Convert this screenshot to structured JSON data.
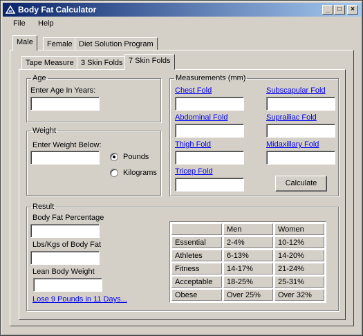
{
  "window": {
    "title": "Body Fat Calculator",
    "minimize": "_",
    "maximize": "□",
    "close": "×"
  },
  "menu": {
    "file": "File",
    "help": "Help"
  },
  "main_tabs": [
    "Male",
    "Female",
    "Diet Solution Program"
  ],
  "sub_tabs": [
    "Tape Measure",
    "3 Skin Folds",
    "7 Skin Folds"
  ],
  "age": {
    "legend": "Age",
    "label": "Enter Age In Years:",
    "value": ""
  },
  "weight": {
    "legend": "Weight",
    "label": "Enter Weight Below:",
    "value": "",
    "pounds": "Pounds",
    "kilograms": "Kilograms",
    "selected": "Pounds"
  },
  "measurements": {
    "legend": "Measurements (mm)",
    "chest": "Chest Fold",
    "subscapular": "Subscapular Fold",
    "abdominal": "Abdominal Fold",
    "suprailiac": "Suprailiac Fold",
    "thigh": "Thigh Fold",
    "midaxillary": "Midaxillary Fold",
    "tricep": "Tricep Fold",
    "calculate": "Calculate"
  },
  "result": {
    "legend": "Result",
    "bodyfat_pct": "Body Fat Percentage",
    "fat_mass": "Lbs/Kgs of Body Fat",
    "lean_weight": "Lean Body Weight",
    "promo_link": "Lose 9 Pounds in 11 Days..."
  },
  "table": {
    "headers": [
      "",
      "Men",
      "Women"
    ],
    "rows": [
      [
        "Essential",
        "2-4%",
        "10-12%"
      ],
      [
        "Athletes",
        "6-13%",
        "14-20%"
      ],
      [
        "Fitness",
        "14-17%",
        "21-24%"
      ],
      [
        "Acceptable",
        "18-25%",
        "25-31%"
      ],
      [
        "Obese",
        "Over 25%",
        "Over 32%"
      ]
    ]
  }
}
